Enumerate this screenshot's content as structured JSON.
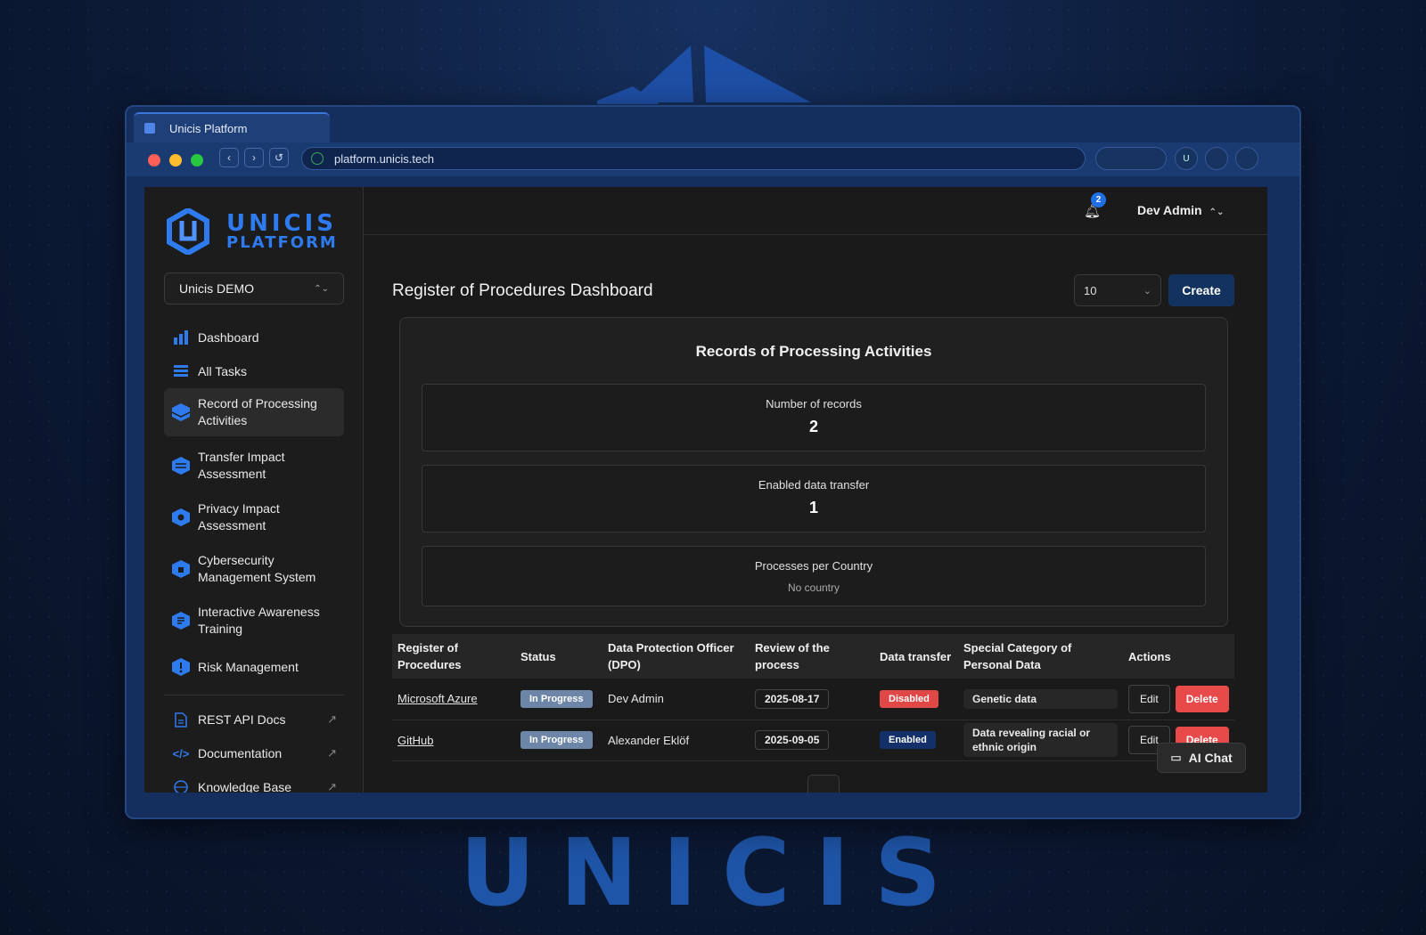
{
  "browser": {
    "tab_title": "Unicis Platform",
    "url": "platform.unicis.tech",
    "profile_initial": "U"
  },
  "brand": {
    "bottom_wordmark": "UNICIS",
    "sidebar_logo_line1": "UNICIS",
    "sidebar_logo_line2": "PLATFORM"
  },
  "sidebar": {
    "org_selector": "Unicis DEMO",
    "items": [
      {
        "label": "Dashboard",
        "icon": "bar-chart-icon"
      },
      {
        "label": "All Tasks",
        "icon": "stack-icon"
      },
      {
        "label": "Record of Processing Activities",
        "icon": "ropa-icon",
        "active": true
      },
      {
        "label": "Transfer Impact Assessment",
        "icon": "transfer-icon"
      },
      {
        "label": "Privacy Impact Assessment",
        "icon": "privacy-icon"
      },
      {
        "label": "Cybersecurity Management System",
        "icon": "cyber-icon"
      },
      {
        "label": "Interactive Awareness Training",
        "icon": "training-icon"
      },
      {
        "label": "Risk Management",
        "icon": "risk-icon"
      }
    ],
    "links": [
      {
        "label": "REST API Docs",
        "icon": "document-icon"
      },
      {
        "label": "Documentation",
        "icon": "code-icon"
      },
      {
        "label": "Knowledge Base",
        "icon": "globe-icon"
      }
    ]
  },
  "header": {
    "notification_count": "2",
    "user_name": "Dev Admin"
  },
  "main": {
    "title": "Register of Procedures Dashboard",
    "page_size": "10",
    "create_label": "Create"
  },
  "summary": {
    "title": "Records of Processing Activities",
    "records_label": "Number of records",
    "records_value": "2",
    "transfer_label": "Enabled data transfer",
    "transfer_value": "1",
    "country_label": "Processes per Country",
    "country_value": "No country"
  },
  "table": {
    "headers": [
      "Register of Procedures",
      "Status",
      "Data Protection Officer (DPO)",
      "Review of the process",
      "Data transfer",
      "Special Category of Personal Data",
      "Actions"
    ],
    "rows": [
      {
        "name": "Microsoft Azure",
        "status": "In Progress",
        "dpo": "Dev Admin",
        "review": "2025-08-17",
        "transfer": "Disabled",
        "special": "Genetic data",
        "edit": "Edit",
        "delete": "Delete"
      },
      {
        "name": "GitHub",
        "status": "In Progress",
        "dpo": "Alexander Eklöf",
        "review": "2025-09-05",
        "transfer": "Enabled",
        "special": "Data revealing racial or ethnic origin",
        "edit": "Edit",
        "delete": "Delete"
      }
    ]
  },
  "chat": {
    "label": "AI Chat"
  },
  "colors": {
    "accent": "#2e7bf0",
    "danger": "#e84a4a",
    "primary_button": "#14325f",
    "background": "#0c1a36"
  }
}
